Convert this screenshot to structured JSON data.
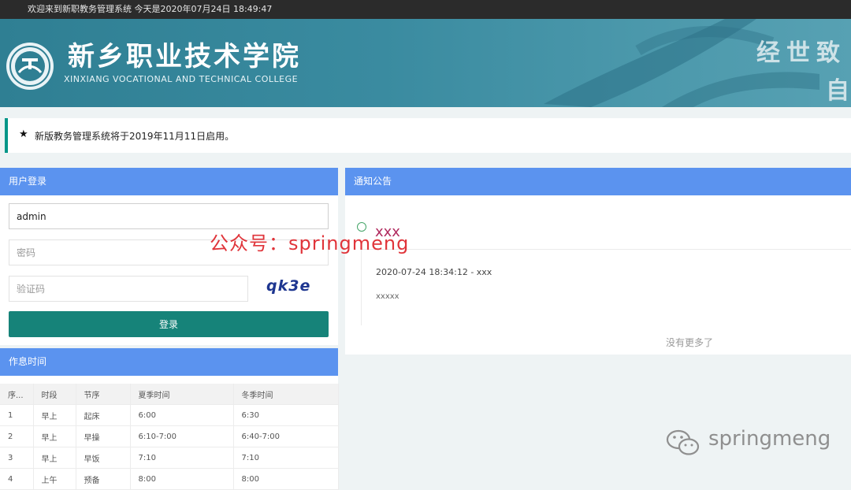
{
  "topbar": {
    "welcome": "欢迎来到新职教务管理系统   今天是2020年07月24日 18:49:47"
  },
  "banner": {
    "cn_title": "新乡职业技术学院",
    "en_title": "XINXIANG VOCATIONAL AND TECHNICAL COLLEGE",
    "motto_line1": "经世致",
    "motto_line2": "自",
    "logo_icon": "college-emblem-icon"
  },
  "notice": {
    "star": "★",
    "text": "新版教务管理系统将于2019年11月11日启用。"
  },
  "login": {
    "header": "用户登录",
    "username_value": "admin",
    "password_placeholder": "密码",
    "captcha_placeholder": "验证码",
    "captcha_text": "qk3e",
    "login_button": "登录"
  },
  "schedule": {
    "header": "作息时间",
    "columns": [
      "序...",
      "时段",
      "节序",
      "夏季时间",
      "冬季时间"
    ],
    "rows": [
      [
        "1",
        "早上",
        "起床",
        "6:00",
        "6:30"
      ],
      [
        "2",
        "早上",
        "早操",
        "6:10-7:00",
        "6:40-7:00"
      ],
      [
        "3",
        "早上",
        "早饭",
        "7:10",
        "7:10"
      ],
      [
        "4",
        "上午",
        "预备",
        "8:00",
        "8:00"
      ]
    ]
  },
  "announce": {
    "header": "通知公告",
    "title": "xxx",
    "meta": "2020-07-24 18:34:12 - xxx",
    "content": "xxxxx",
    "no_more": "没有更多了"
  },
  "watermarks": {
    "red": "公众号：springmeng",
    "gray": "springmeng",
    "gray_icon": "wechat-icon"
  },
  "colors": {
    "accent_blue": "#5b93ef",
    "login_green": "#168379",
    "notice_border": "#009688",
    "banner_teal": "#3a8ba0"
  }
}
